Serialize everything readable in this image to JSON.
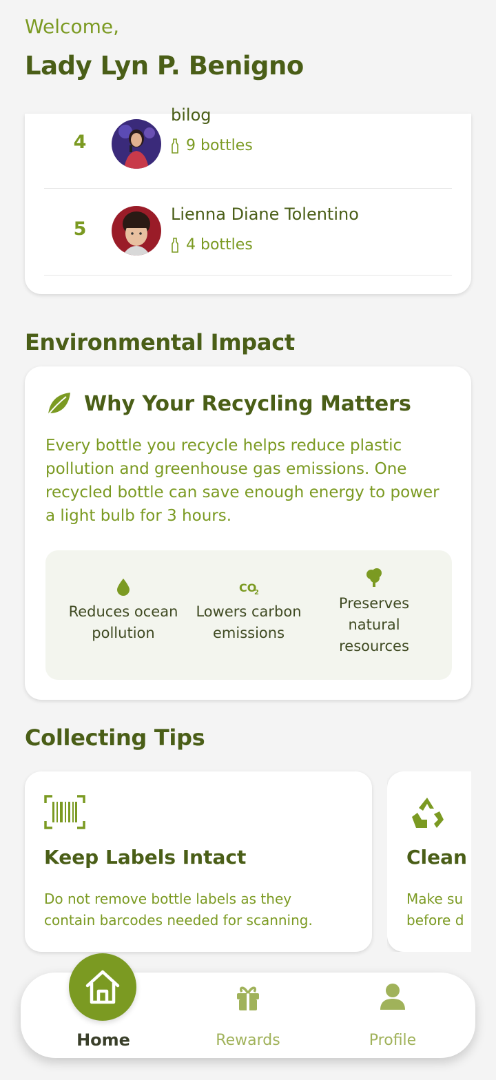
{
  "header": {
    "welcome": "Welcome,",
    "username": "Lady Lyn P. Benigno"
  },
  "leaderboard": {
    "rows": [
      {
        "rank": "4",
        "name": "bilog",
        "bottles": "9 bottles"
      },
      {
        "rank": "5",
        "name": "Lienna Diane Tolentino",
        "bottles": "4 bottles"
      }
    ]
  },
  "environmental": {
    "section_title": "Environmental Impact",
    "card_title": "Why Your Recycling Matters",
    "body": "Every bottle you recycle helps reduce plastic pollution and greenhouse gas emissions. One recycled bottle can save enough energy to power a light bulb for 3 hours.",
    "benefits": [
      {
        "icon": "water-drop-icon",
        "label": "Reduces ocean pollution"
      },
      {
        "icon": "co2-icon",
        "label": "Lowers carbon emissions"
      },
      {
        "icon": "tree-icon",
        "label": "Preserves natural resources"
      }
    ]
  },
  "tips": {
    "section_title": "Collecting Tips",
    "items": [
      {
        "icon": "barcode-scan-icon",
        "title": "Keep Labels Intact",
        "body_line1": "Do not remove bottle labels as they",
        "body_line2": "contain barcodes needed for scanning."
      },
      {
        "icon": "recycle-icon",
        "title": "Clean",
        "body_line1": "Make su",
        "body_line2": "before d"
      }
    ]
  },
  "nav": {
    "items": [
      {
        "icon": "home-icon",
        "label": "Home",
        "active": true
      },
      {
        "icon": "gift-icon",
        "label": "Rewards",
        "active": false
      },
      {
        "icon": "person-icon",
        "label": "Profile",
        "active": false
      }
    ]
  },
  "colors": {
    "primary": "#7b9a22",
    "dark_green": "#4a5e17",
    "background": "#f4f4f4",
    "benefit_panel": "#f3f5ee",
    "inactive_nav": "#a0b25a"
  }
}
